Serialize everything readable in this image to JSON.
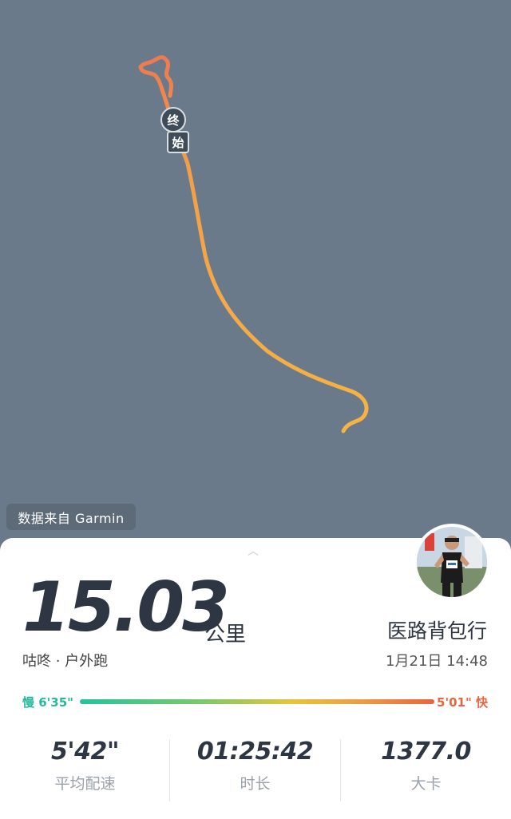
{
  "map": {
    "start_label": "始",
    "end_label": "终",
    "route_colors": {
      "start": "#ee7a4e",
      "end": "#f4b444"
    },
    "background_color": "#6b7a8a"
  },
  "source_badge": "数据来自 Garmin",
  "summary": {
    "distance": "15.03",
    "unit": "公里",
    "subtitle": "咕咚 · 户外跑",
    "username": "医路背包行",
    "datetime": "1月21日 14:48"
  },
  "pace_range": {
    "slow_label": "慢 6'35\"",
    "fast_label": "5'01\" 快",
    "slow_color": "#24c39b",
    "fast_color": "#e8653d"
  },
  "stats": [
    {
      "value": "5'42\"",
      "label": "平均配速"
    },
    {
      "value": "01:25:42",
      "label": "时长"
    },
    {
      "value": "1377.0",
      "label": "大卡"
    }
  ],
  "icons": {
    "handle": "chevron-up-icon",
    "avatar": "user-avatar-photo"
  }
}
